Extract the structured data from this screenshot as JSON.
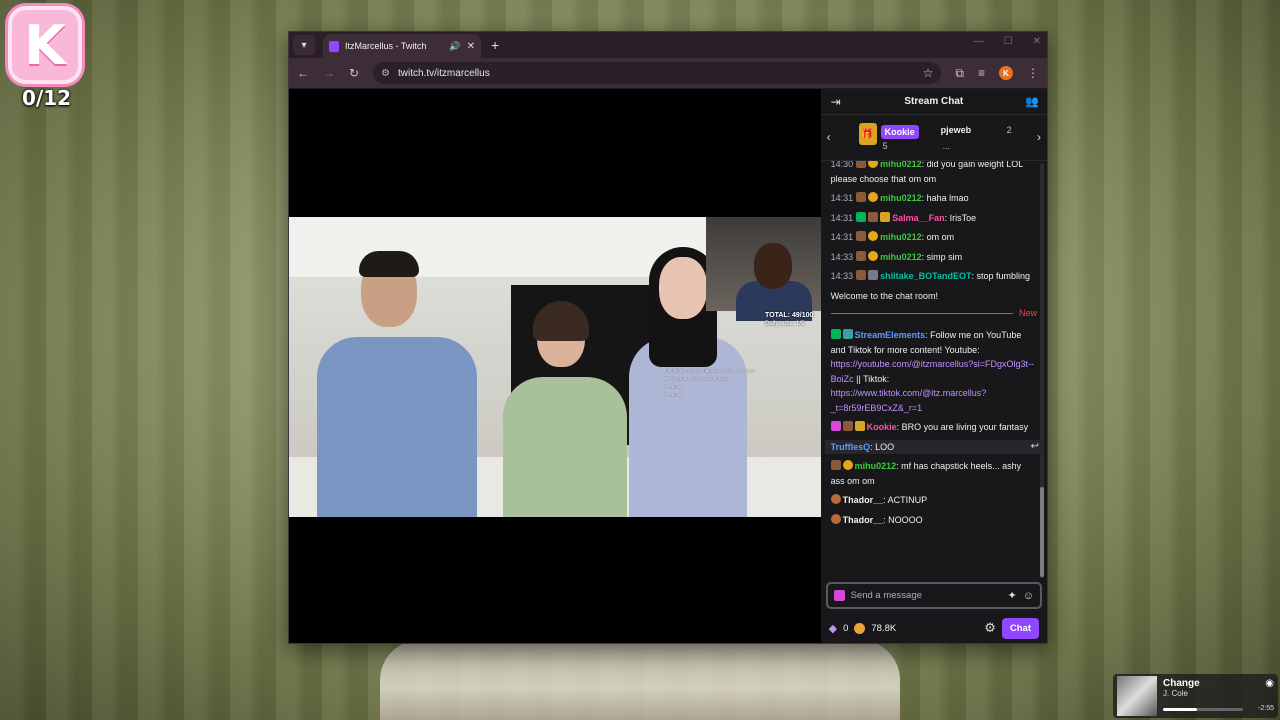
{
  "overlay": {
    "k_letter": "K",
    "counter": "0/12"
  },
  "browser": {
    "tab_title": "ItzMarcellus - Twitch",
    "url": "twitch.tv/itzmarcellus",
    "profile_initial": "K"
  },
  "stream": {
    "total_label": "TOTAL: 49/100",
    "daily_subs": "Daily subs: 1/5",
    "overlay_chat": [
      "mihu0212: mf has chapstick heels... ashy ass",
      "BRO you are living your fantasy",
      "Thador__",
      "Thador__"
    ]
  },
  "chat": {
    "title": "Stream Chat",
    "gifters": [
      {
        "name": "Kookie",
        "count": "5"
      },
      {
        "name": "pjeweb",
        "count": "2"
      }
    ],
    "gifters_more": "...",
    "messages": [
      {
        "ts": "14:30",
        "user": "mihu0212",
        "color": "#3cc93c",
        "text": ": did you gain weight LOL please choose that om om"
      },
      {
        "ts": "14:31",
        "user": "mihu0212",
        "color": "#3cc93c",
        "text": ": haha lmao"
      },
      {
        "ts": "14:31",
        "user": "Salma__Fan",
        "color": "#ff4fa8",
        "text": ": IrisToe"
      },
      {
        "ts": "14:31",
        "user": "mihu0212",
        "color": "#3cc93c",
        "text": ": om om"
      },
      {
        "ts": "14:33",
        "user": "mihu0212",
        "color": "#3cc93c",
        "text": ": simp sim"
      },
      {
        "ts": "14:33",
        "user": "shiitake_BOTandEOT",
        "color": "#00c2a8",
        "text": ": stop fumbling"
      }
    ],
    "welcome": "Welcome to the chat room!",
    "new_label": "New",
    "streamelements": {
      "user": "StreamElements",
      "text1": ": Follow me on YouTube and Tiktok for more content! Youtube:",
      "link1": "https://youtube.com/@itzmarcellus?si=FDgxOlg3t--BoiZc",
      "sep": " || Tiktok:",
      "link2": "https://www.tiktok.com/@itz.marcellus?_t=8r59rEB9CxZ&_r=1"
    },
    "kookie_msg": {
      "user": "Kookie",
      "text": ": BRO you are living your fantasy"
    },
    "truffles_msg": {
      "user": "TrufflesQ",
      "text": ": LOO"
    },
    "mihu_msg": {
      "user": "mihu0212",
      "text": ": mf has chapstick heels... ashy ass om om"
    },
    "thador_msgs": [
      {
        "user": "Thador__",
        "text": ": ACTINUP"
      },
      {
        "user": "Thador__",
        "text": ": NOOOO"
      }
    ],
    "input_placeholder": "Send a message",
    "points": "0",
    "coins": "78.8K",
    "chat_button": "Chat"
  },
  "now_playing": {
    "title": "Change",
    "artist": "J. Cole",
    "time": "-2:55",
    "progress": 0.42
  }
}
